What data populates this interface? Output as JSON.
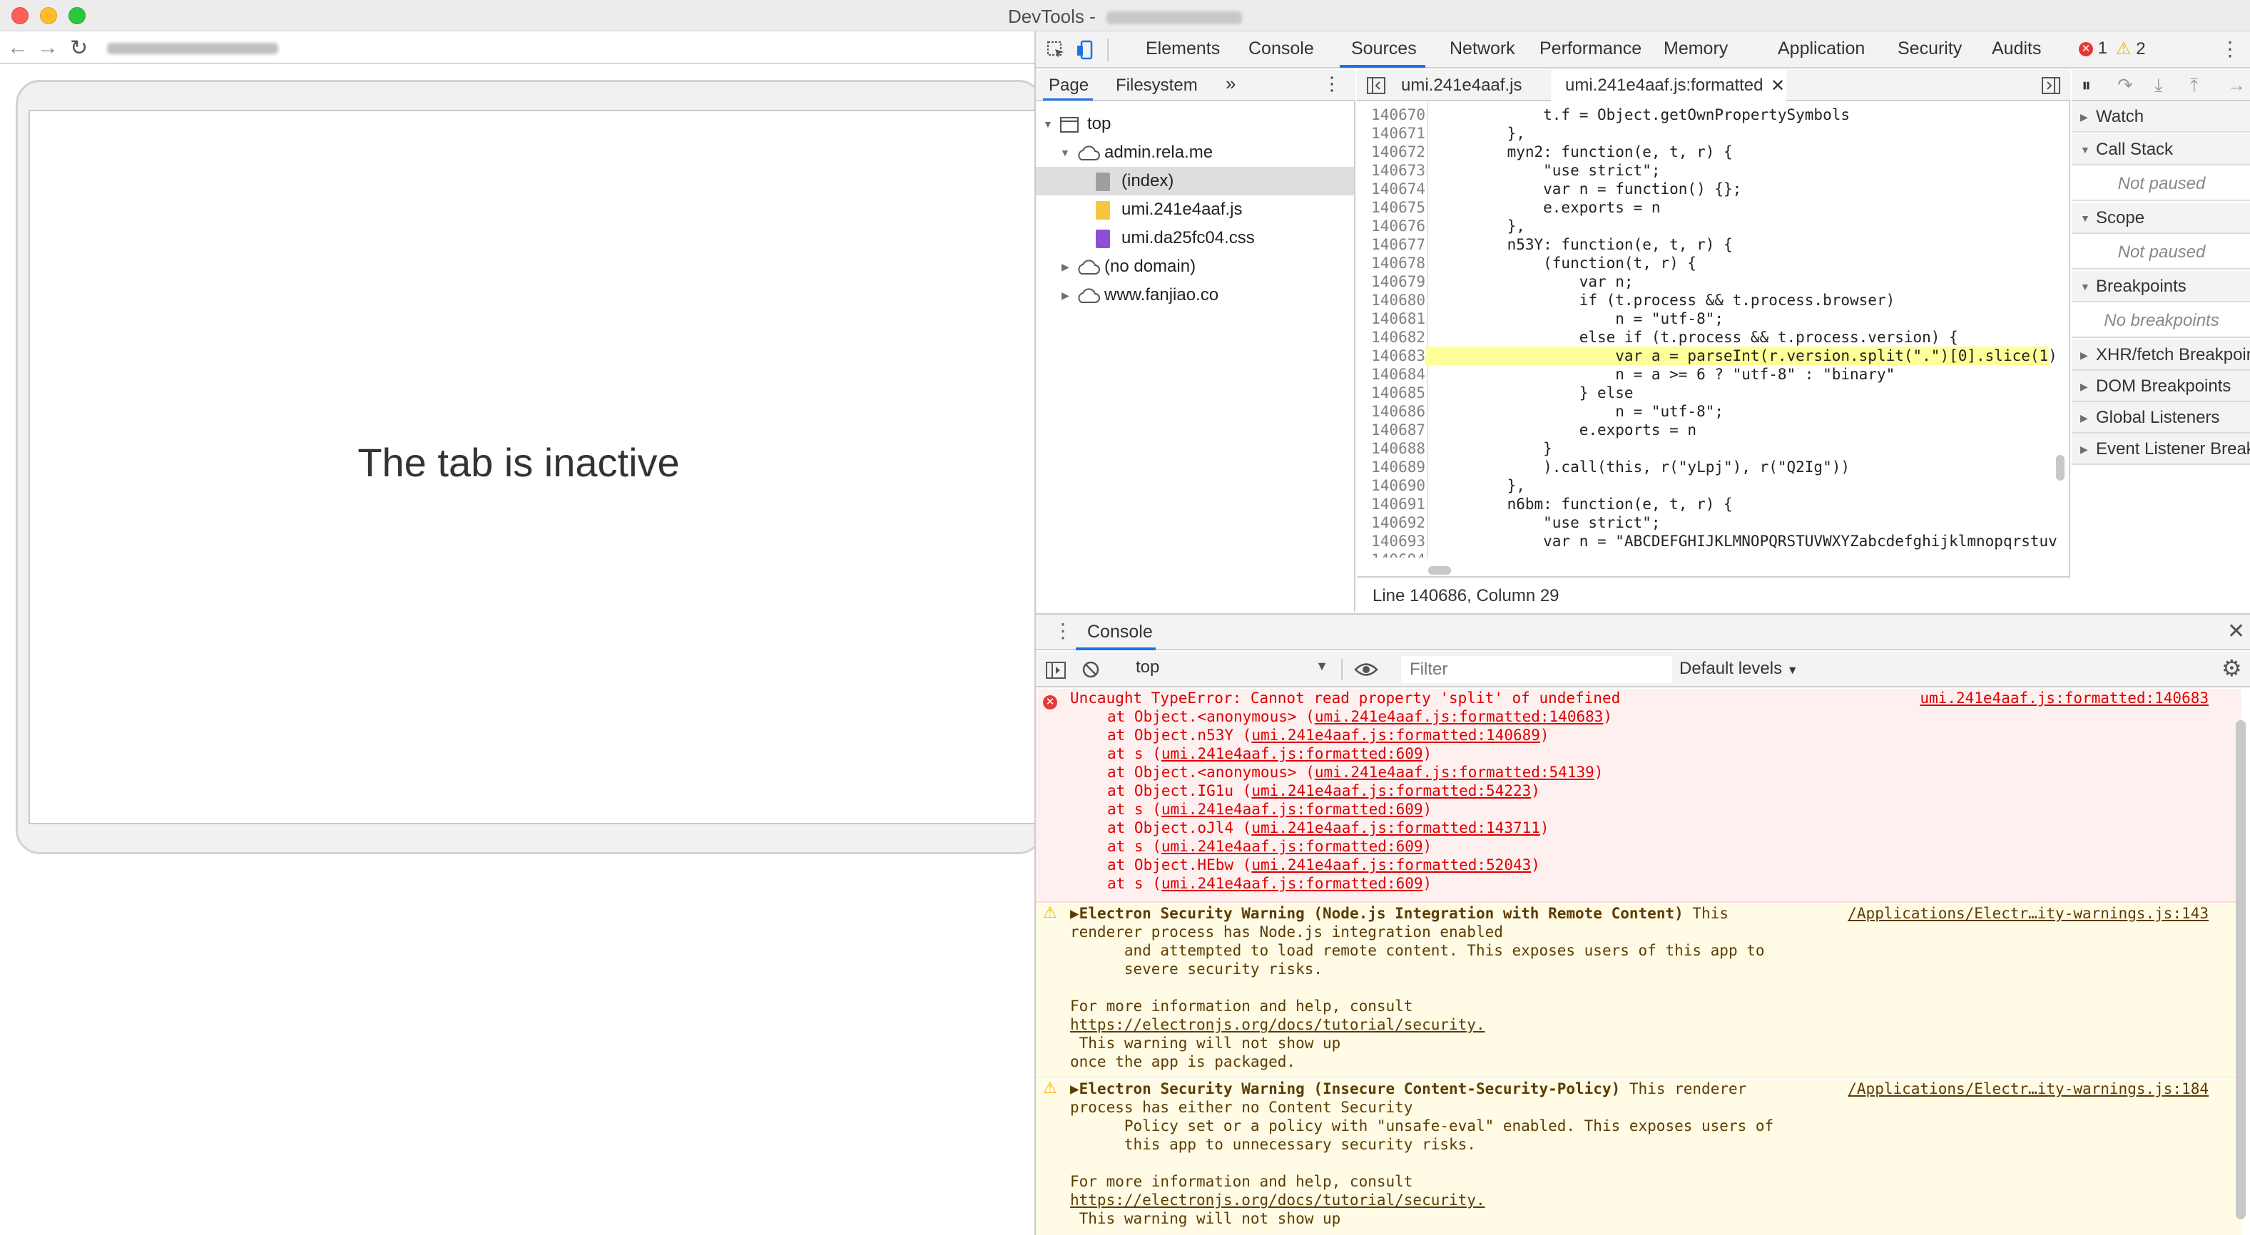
{
  "window": {
    "title": "DevTools - "
  },
  "browser": {
    "inactive_text": "The tab is inactive"
  },
  "devtools": {
    "tabs": [
      "Elements",
      "Console",
      "Sources",
      "Network",
      "Performance",
      "Memory",
      "Application",
      "Security",
      "Audits"
    ],
    "active_tab": "Sources",
    "error_count": "1",
    "warning_count": "2"
  },
  "navigator": {
    "tabs": [
      "Page",
      "Filesystem"
    ],
    "tree": [
      {
        "label": "top"
      },
      {
        "label": "admin.rela.me"
      },
      {
        "label": "(index)"
      },
      {
        "label": "umi.241e4aaf.js"
      },
      {
        "label": "umi.da25fc04.css"
      },
      {
        "label": "(no domain)"
      },
      {
        "label": "www.fanjiao.co"
      }
    ]
  },
  "editor": {
    "tabs": [
      "umi.241e4aaf.js",
      "umi.241e4aaf.js:formatted"
    ],
    "status": "Line 140686, Column 29",
    "lines": [
      {
        "n": "140670",
        "t": "        t.f = Object.getOwnPropertySymbols"
      },
      {
        "n": "140671",
        "t": "    },"
      },
      {
        "n": "140672",
        "t": "    myn2: function(e, t, r) {"
      },
      {
        "n": "140673",
        "t": "        \"use strict\";"
      },
      {
        "n": "140674",
        "t": "        var n = function() {};"
      },
      {
        "n": "140675",
        "t": "        e.exports = n"
      },
      {
        "n": "140676",
        "t": "    },"
      },
      {
        "n": "140677",
        "t": "    n53Y: function(e, t, r) {"
      },
      {
        "n": "140678",
        "t": "        (function(t, r) {"
      },
      {
        "n": "140679",
        "t": "            var n;"
      },
      {
        "n": "140680",
        "t": "            if (t.process && t.process.browser)"
      },
      {
        "n": "140681",
        "t": "                n = \"utf-8\";"
      },
      {
        "n": "140682",
        "t": "            else if (t.process && t.process.version) {"
      },
      {
        "n": "140683",
        "t": "                var a = parseInt(r.version.split(\".\")[0].slice(1)"
      },
      {
        "n": "140684",
        "t": "                n = a >= 6 ? \"utf-8\" : \"binary\""
      },
      {
        "n": "140685",
        "t": "            } else"
      },
      {
        "n": "140686",
        "t": "                n = \"utf-8\";"
      },
      {
        "n": "140687",
        "t": "            e.exports = n"
      },
      {
        "n": "140688",
        "t": "        }"
      },
      {
        "n": "140689",
        "t": "        ).call(this, r(\"yLpj\"), r(\"Q2Ig\"))"
      },
      {
        "n": "140690",
        "t": "    },"
      },
      {
        "n": "140691",
        "t": "    n6bm: function(e, t, r) {"
      },
      {
        "n": "140692",
        "t": "        \"use strict\";"
      },
      {
        "n": "140693",
        "t": "        var n = \"ABCDEFGHIJKLMNOPQRSTUVWXYZabcdefghijklmnopqrstuv"
      },
      {
        "n": "140694",
        "t": ""
      }
    ]
  },
  "debugger": {
    "sections": [
      {
        "label": "Watch"
      },
      {
        "label": "Call Stack",
        "empty": "Not paused"
      },
      {
        "label": "Scope",
        "empty": "Not paused"
      },
      {
        "label": "Breakpoints",
        "empty": "No breakpoints"
      },
      {
        "label": "XHR/fetch Breakpoints"
      },
      {
        "label": "DOM Breakpoints"
      },
      {
        "label": "Global Listeners"
      },
      {
        "label": "Event Listener Breakpoints"
      }
    ]
  },
  "console": {
    "title": "Console",
    "context": "top",
    "filter_placeholder": "Filter",
    "levels": "Default levels",
    "error": {
      "message": "Uncaught TypeError: Cannot read property 'split' of undefined",
      "source": "umi.241e4aaf.js:formatted:140683",
      "stack": [
        {
          "fn": "at Object.<anonymous>",
          "loc": "umi.241e4aaf.js:formatted:140683"
        },
        {
          "fn": "at Object.n53Y",
          "loc": "umi.241e4aaf.js:formatted:140689"
        },
        {
          "fn": "at s",
          "loc": "umi.241e4aaf.js:formatted:609"
        },
        {
          "fn": "at Object.<anonymous>",
          "loc": "umi.241e4aaf.js:formatted:54139"
        },
        {
          "fn": "at Object.IG1u",
          "loc": "umi.241e4aaf.js:formatted:54223"
        },
        {
          "fn": "at s",
          "loc": "umi.241e4aaf.js:formatted:609"
        },
        {
          "fn": "at Object.oJl4",
          "loc": "umi.241e4aaf.js:formatted:143711"
        },
        {
          "fn": "at s",
          "loc": "umi.241e4aaf.js:formatted:609"
        },
        {
          "fn": "at Object.HEbw",
          "loc": "umi.241e4aaf.js:formatted:52043"
        },
        {
          "fn": "at s",
          "loc": "umi.241e4aaf.js:formatted:609"
        }
      ]
    },
    "warn1": {
      "title": "Electron Security Warning (Node.js Integration with Remote Content)",
      "source": "/Applications/Electr…ity-warnings.js:143",
      "lines": [
        "This",
        "renderer process has Node.js integration enabled",
        "      and attempted to load remote content. This exposes users of this app to",
        "      severe security risks.",
        "",
        "For more information and help, consult",
        "https://electronjs.org/docs/tutorial/security.",
        " This warning will not show up",
        "once the app is packaged."
      ]
    },
    "warn2": {
      "title": "Electron Security Warning (Insecure Content-Security-Policy)",
      "source": "/Applications/Electr…ity-warnings.js:184",
      "lines": [
        "This renderer",
        "process has either no Content Security",
        "      Policy set or a policy with \"unsafe-eval\" enabled. This exposes users of",
        "      this app to unnecessary security risks.",
        "",
        "For more information and help, consult",
        "https://electronjs.org/docs/tutorial/security.",
        " This warning will not show up"
      ]
    }
  }
}
